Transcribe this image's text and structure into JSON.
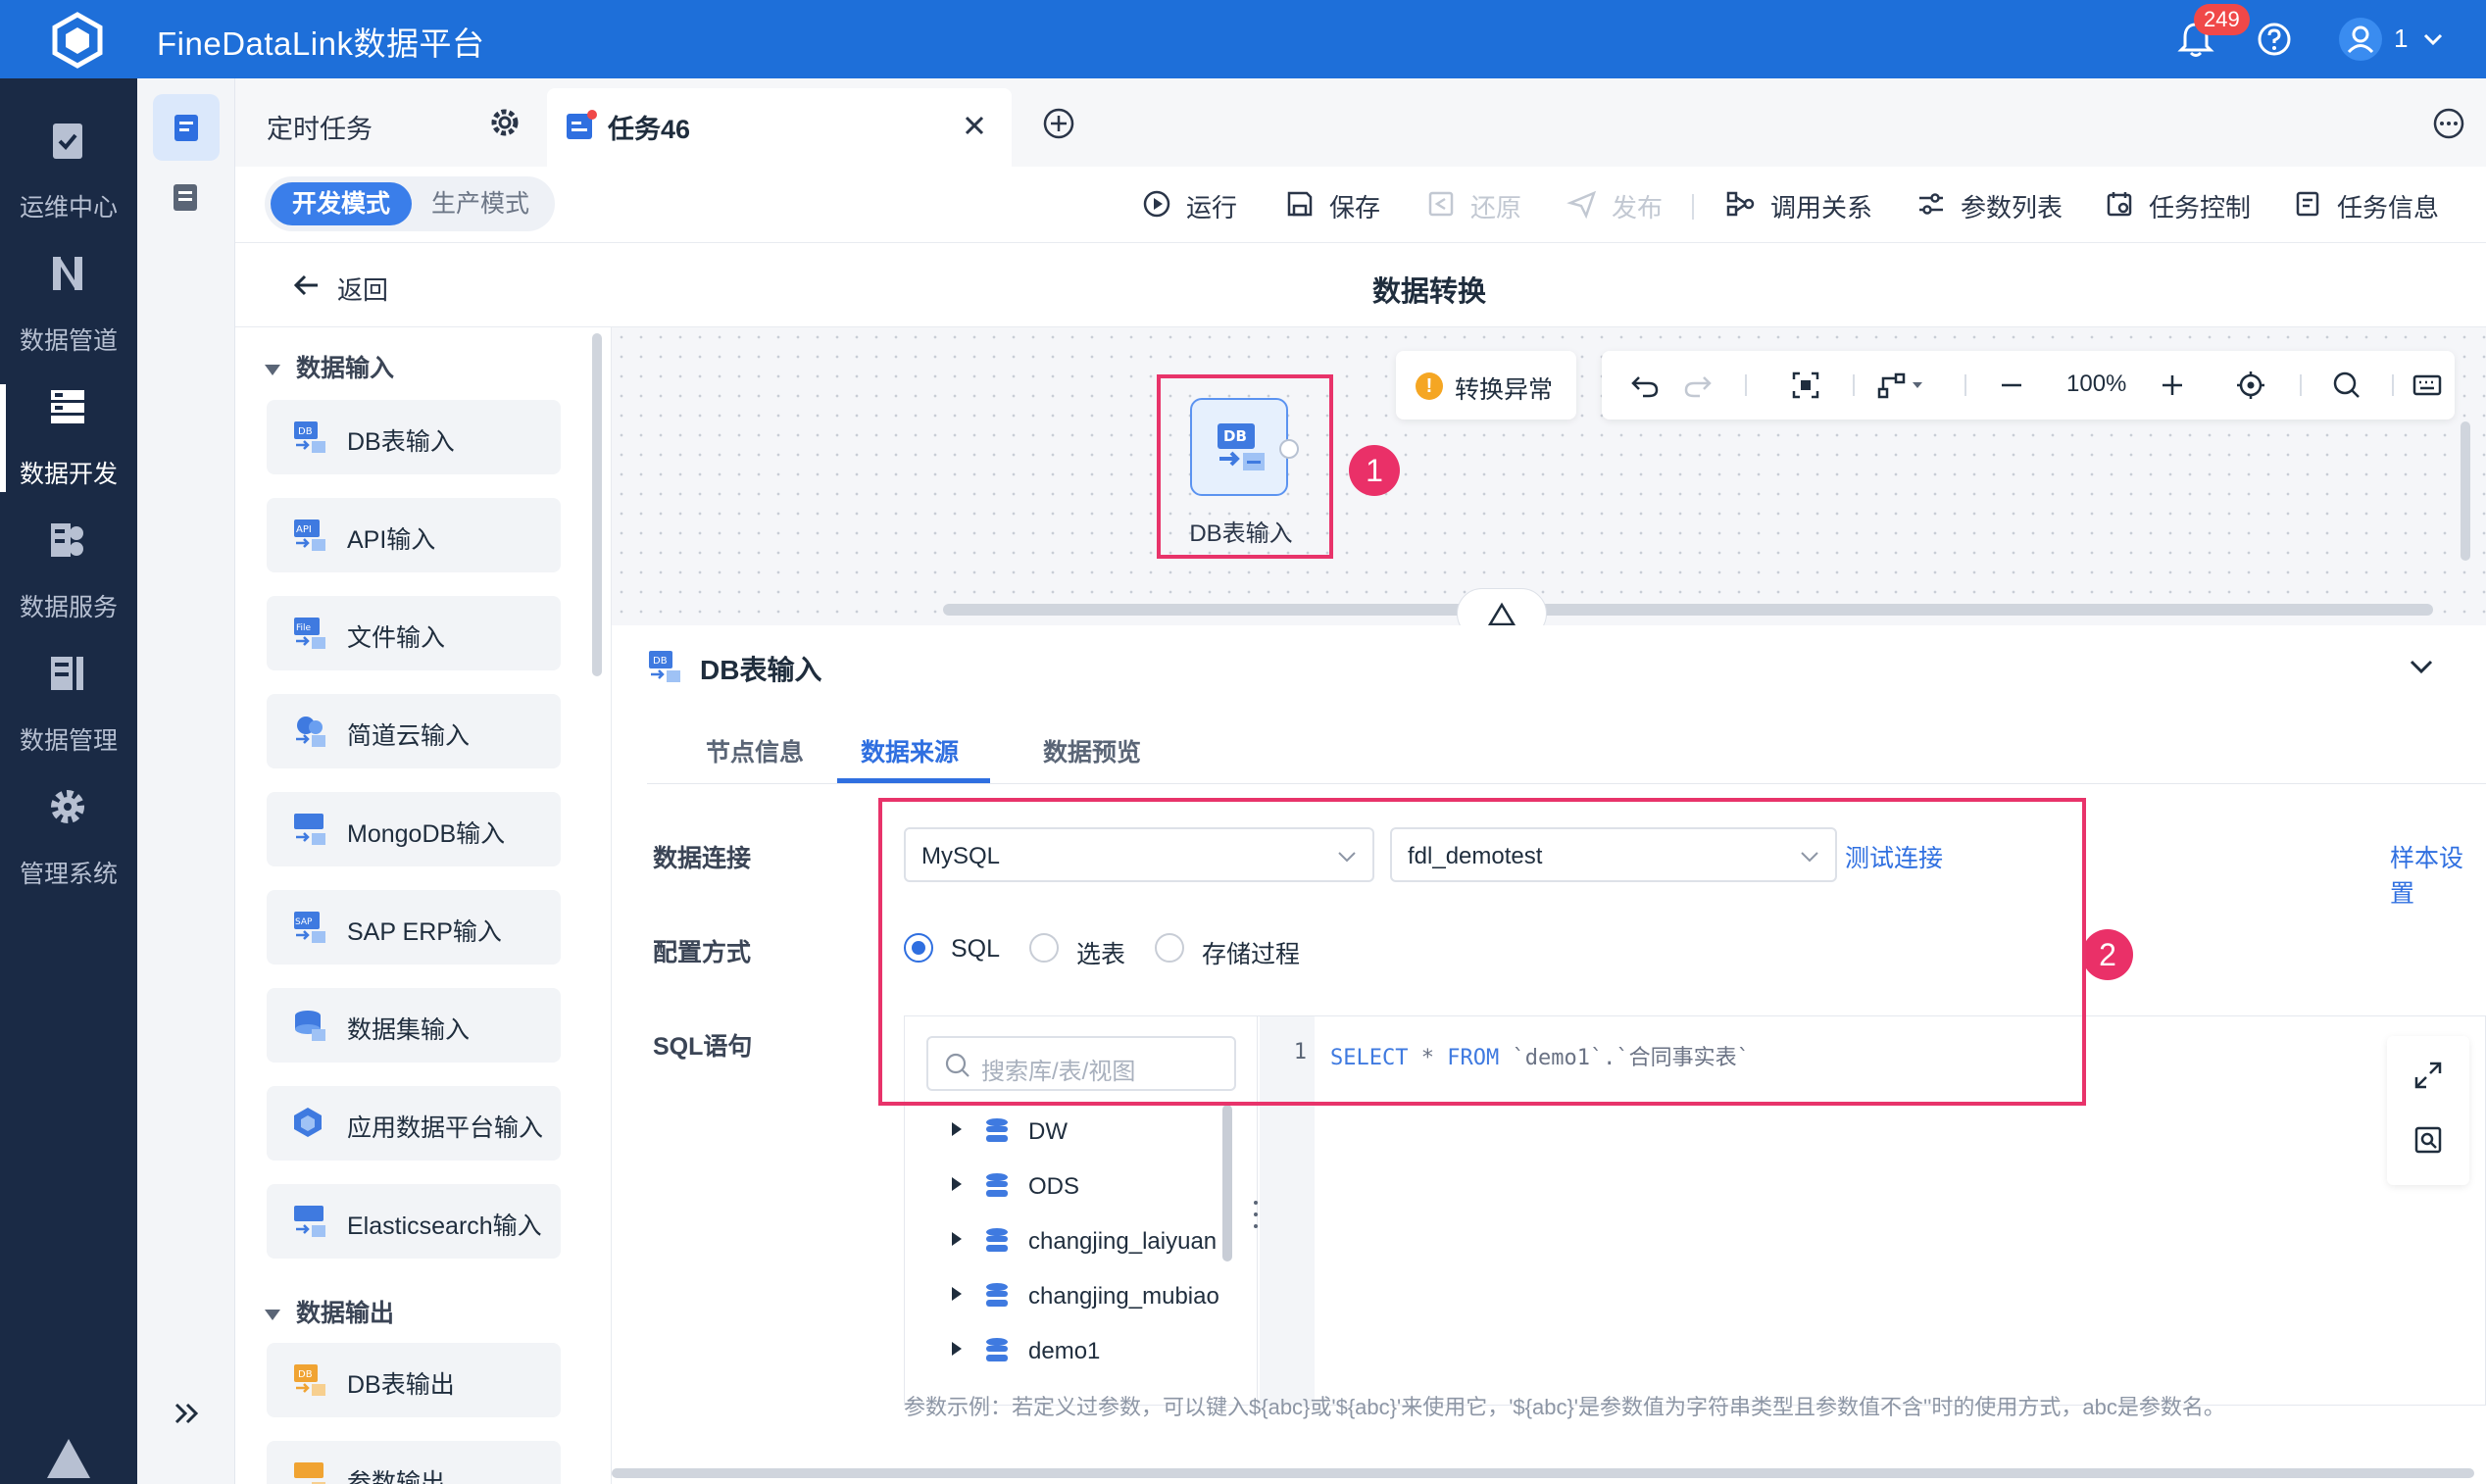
{
  "app": {
    "title": "FineDataLink数据平台",
    "notification_count": "249",
    "user_name": "1"
  },
  "leftnav": {
    "items": [
      {
        "label": "运维中心",
        "icon": "clipboard-check-icon"
      },
      {
        "label": "数据管道",
        "icon": "pipeline-icon"
      },
      {
        "label": "数据开发",
        "icon": "server-stack-icon",
        "active": true
      },
      {
        "label": "数据服务",
        "icon": "service-icon"
      },
      {
        "label": "数据管理",
        "icon": "data-management-icon"
      },
      {
        "label": "管理系统",
        "icon": "gear-icon"
      }
    ]
  },
  "tabs": {
    "items": [
      {
        "label": "定时任务"
      },
      {
        "label": "任务46",
        "active": true
      }
    ]
  },
  "toolbar": {
    "mode_dev": "开发模式",
    "mode_prod": "生产模式",
    "run": "运行",
    "save": "保存",
    "restore": "还原",
    "publish": "发布",
    "call_relation": "调用关系",
    "param_list": "参数列表",
    "task_control": "任务控制",
    "task_info": "任务信息"
  },
  "subhead": {
    "back": "返回",
    "title": "数据转换"
  },
  "components": {
    "input_category": "数据输入",
    "inputs": [
      "DB表输入",
      "API输入",
      "文件输入",
      "简道云输入",
      "MongoDB输入",
      "SAP ERP输入",
      "数据集输入",
      "应用数据平台输入",
      "Elasticsearch输入"
    ],
    "output_category": "数据输出",
    "outputs": [
      "DB表输出",
      "参数输出"
    ]
  },
  "canvas": {
    "node_label": "DB表输入",
    "node_icon_text": "DB",
    "marker1": "1",
    "warning": "转换异常",
    "zoom": "100%"
  },
  "config": {
    "title": "DB表输入",
    "tabs": [
      "节点信息",
      "数据来源",
      "数据预览"
    ],
    "active_tab": "数据来源",
    "connection_label": "数据连接",
    "db_type": "MySQL",
    "db_name": "fdl_demotest",
    "test_connection": "测试连接",
    "sample_settings": "样本设置",
    "config_mode_label": "配置方式",
    "config_modes": [
      "SQL",
      "选表",
      "存储过程"
    ],
    "selected_mode": "SQL",
    "sql_label": "SQL语句",
    "search_placeholder": "搜索库/表/视图",
    "tree": [
      "DW",
      "ODS",
      "changjing_laiyuan",
      "changjing_mubiao",
      "demo1"
    ],
    "line_number": "1",
    "sql_kw1": "SELECT",
    "sql_star": "*",
    "sql_kw2": "FROM",
    "sql_rest": "`demo1`.`合同事实表`",
    "hint": "参数示例：若定义过参数，可以键入${abc}或'${abc}'来使用它，'${abc}'是参数值为字符串类型且参数值不含''时的使用方式，abc是参数名。",
    "marker2": "2"
  }
}
